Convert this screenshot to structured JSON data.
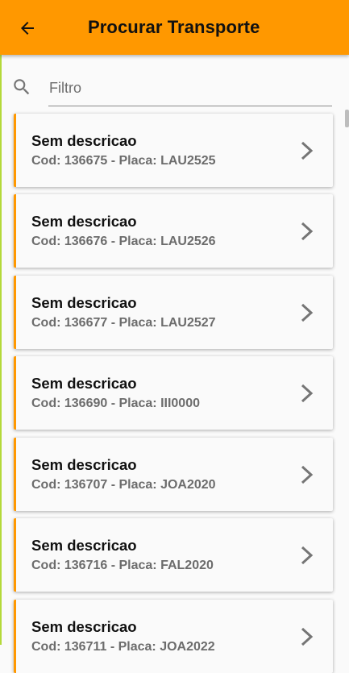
{
  "appbar": {
    "title": "Procurar Transporte",
    "back_icon": "arrow-left-icon"
  },
  "search": {
    "placeholder": "Filtro",
    "value": "",
    "icon": "search-icon"
  },
  "colors": {
    "accent": "#ff9800",
    "card_border": "#ff9800",
    "subtitle": "#6c6c6c"
  },
  "items": [
    {
      "title": "Sem descricao",
      "subtitle": "Cod: 136675 - Placa: LAU2525"
    },
    {
      "title": "Sem descricao",
      "subtitle": "Cod: 136676 - Placa: LAU2526"
    },
    {
      "title": "Sem descricao",
      "subtitle": "Cod: 136677 - Placa: LAU2527"
    },
    {
      "title": "Sem descricao",
      "subtitle": "Cod: 136690 - Placa: III0000"
    },
    {
      "title": "Sem descricao",
      "subtitle": "Cod: 136707 - Placa: JOA2020"
    },
    {
      "title": "Sem descricao",
      "subtitle": "Cod: 136716 - Placa: FAL2020"
    },
    {
      "title": "Sem descricao",
      "subtitle": "Cod: 136711 - Placa: JOA2022"
    }
  ]
}
